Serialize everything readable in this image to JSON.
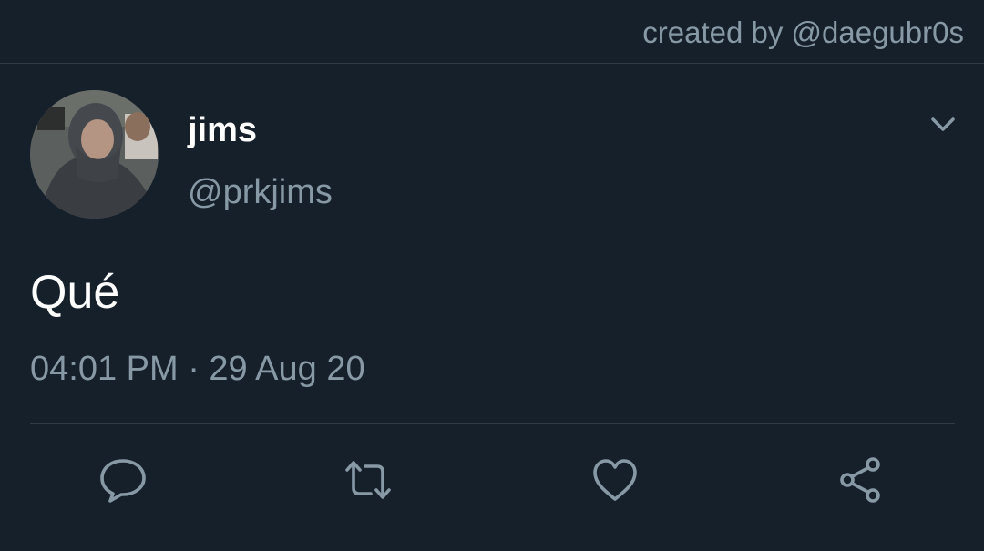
{
  "header": {
    "credit": "created by @daegubr0s"
  },
  "tweet": {
    "display_name": "jims",
    "handle": "@prkjims",
    "text": "Qué",
    "timestamp": "04:01 PM · 29 Aug 20"
  },
  "icons": {
    "menu": "chevron-down-icon",
    "reply": "reply-icon",
    "retweet": "retweet-icon",
    "like": "heart-icon",
    "share": "share-icon"
  },
  "colors": {
    "background": "#16202b",
    "secondary_text": "#8899a6",
    "primary_text": "#ffffff",
    "divider": "#2f3b47"
  }
}
